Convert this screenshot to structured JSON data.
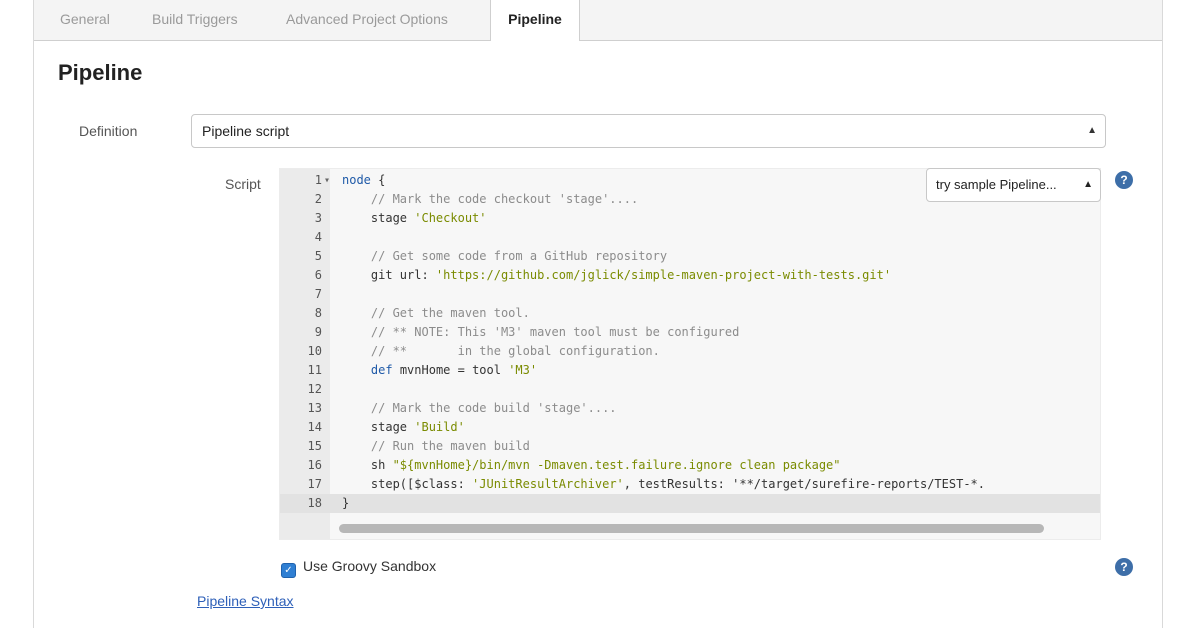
{
  "tabs": [
    {
      "label": "General"
    },
    {
      "label": "Build Triggers"
    },
    {
      "label": "Advanced Project Options"
    },
    {
      "label": "Pipeline"
    }
  ],
  "section_title": "Pipeline",
  "definition": {
    "label": "Definition",
    "value": "Pipeline script"
  },
  "script": {
    "label": "Script",
    "sample_select": "try sample Pipeline...",
    "lines": [
      {
        "n": "1",
        "text": "node {"
      },
      {
        "n": "2",
        "text": "    // Mark the code checkout 'stage'...."
      },
      {
        "n": "3",
        "text": "    stage 'Checkout'"
      },
      {
        "n": "4",
        "text": ""
      },
      {
        "n": "5",
        "text": "    // Get some code from a GitHub repository"
      },
      {
        "n": "6",
        "text": "    git url: 'https://github.com/jglick/simple-maven-project-with-tests.git'"
      },
      {
        "n": "7",
        "text": ""
      },
      {
        "n": "8",
        "text": "    // Get the maven tool."
      },
      {
        "n": "9",
        "text": "    // ** NOTE: This 'M3' maven tool must be configured"
      },
      {
        "n": "10",
        "text": "    // **       in the global configuration."
      },
      {
        "n": "11",
        "text": "    def mvnHome = tool 'M3'"
      },
      {
        "n": "12",
        "text": ""
      },
      {
        "n": "13",
        "text": "    // Mark the code build 'stage'...."
      },
      {
        "n": "14",
        "text": "    stage 'Build'"
      },
      {
        "n": "15",
        "text": "    // Run the maven build"
      },
      {
        "n": "16",
        "text": "    sh \"${mvnHome}/bin/mvn -Dmaven.test.failure.ignore clean package\""
      },
      {
        "n": "17",
        "text": "    step([$class: 'JUnitResultArchiver', testResults: '**/target/surefire-reports/TEST-*."
      },
      {
        "n": "18",
        "text": "}"
      }
    ]
  },
  "sandbox": {
    "label": "Use Groovy Sandbox",
    "checked": true
  },
  "pipeline_syntax_link": "Pipeline Syntax",
  "icons": {
    "help": "help-icon",
    "fold": "fold-arrow-icon",
    "select_arrows": "select-arrows-icon"
  },
  "colors": {
    "comment": "#8c8c8c",
    "string": "#7a8b00",
    "keyword": "#1f5aa8",
    "help": "#3d6ea8",
    "checkbox": "#2f7fd3",
    "link": "#2d5fb8"
  }
}
